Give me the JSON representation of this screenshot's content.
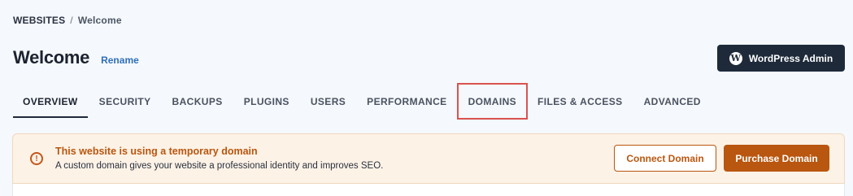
{
  "breadcrumb": {
    "parent": "WEBSITES",
    "separator": "/",
    "current": "Welcome"
  },
  "header": {
    "title": "Welcome",
    "rename_label": "Rename",
    "wp_admin_label": "WordPress Admin"
  },
  "tabs": [
    {
      "label": "OVERVIEW",
      "active": true
    },
    {
      "label": "SECURITY"
    },
    {
      "label": "BACKUPS"
    },
    {
      "label": "PLUGINS"
    },
    {
      "label": "USERS"
    },
    {
      "label": "PERFORMANCE"
    },
    {
      "label": "DOMAINS",
      "highlighted": true
    },
    {
      "label": "FILES & ACCESS"
    },
    {
      "label": "ADVANCED"
    }
  ],
  "alert": {
    "icon": "!",
    "title": "This website is using a temporary domain",
    "description": "A custom domain gives your website a professional identity and improves SEO.",
    "connect_label": "Connect Domain",
    "purchase_label": "Purchase Domain"
  },
  "colors": {
    "accent": "#b9560f",
    "dark": "#1e2a3a",
    "highlight": "#d9534f",
    "link": "#2f6fb8"
  }
}
